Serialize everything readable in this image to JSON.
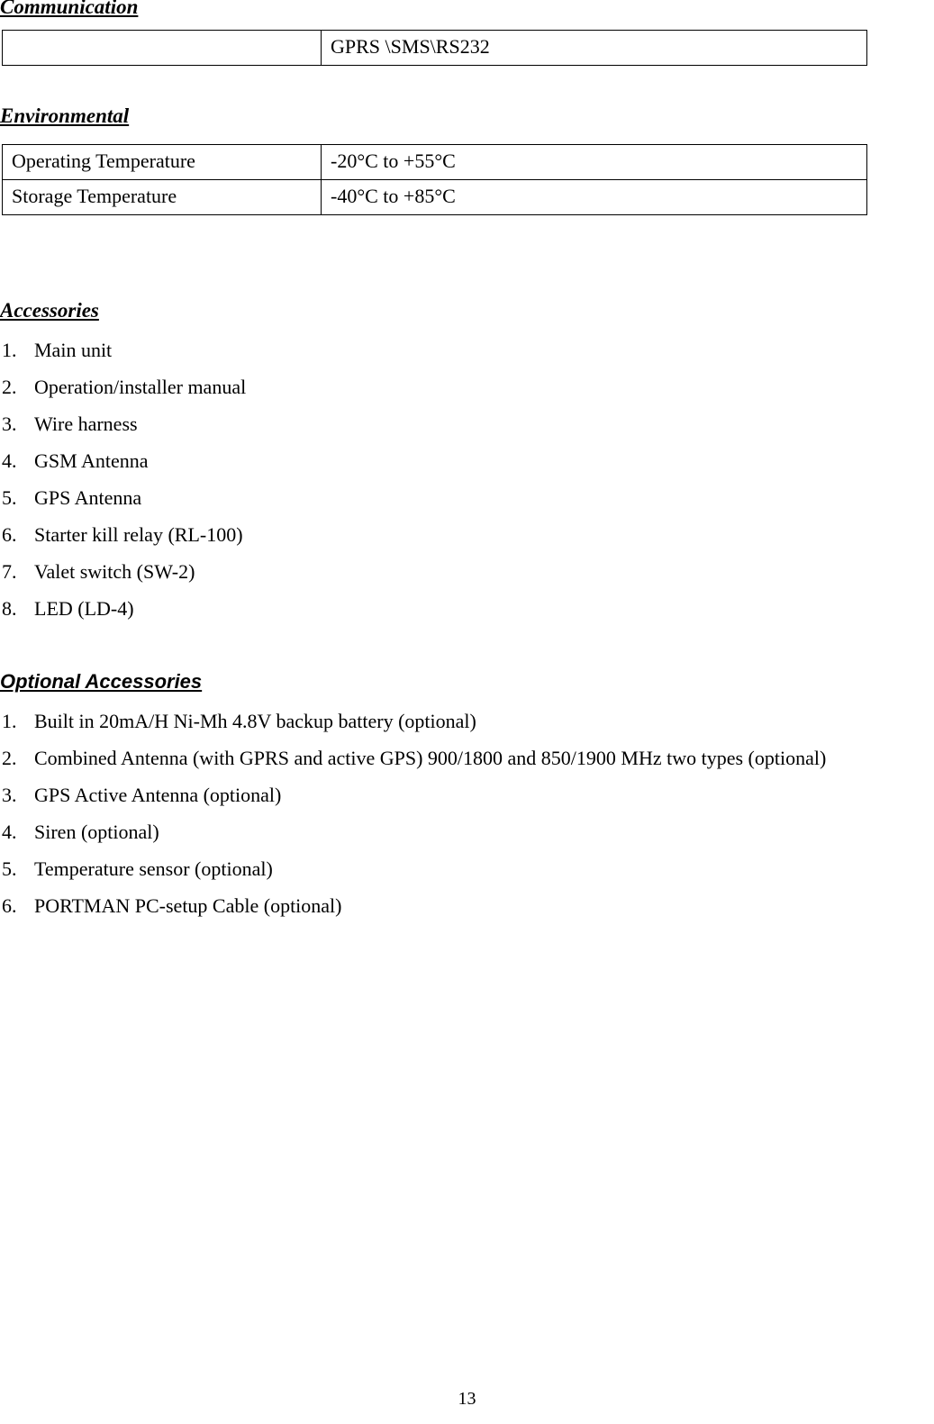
{
  "document": {
    "page_number": "13",
    "sections": {
      "communication": {
        "heading": "Communication",
        "rows": [
          {
            "label": "",
            "value": "GPRS \\SMS\\RS232"
          }
        ]
      },
      "environmental": {
        "heading": "Environmental",
        "rows": [
          {
            "label": "Operating Temperature",
            "value": "-20°C to +55°C"
          },
          {
            "label": "Storage Temperature",
            "value": "-40°C to +85°C"
          }
        ]
      },
      "accessories": {
        "heading": "Accessories",
        "items": [
          {
            "num": "1.",
            "text": "Main unit"
          },
          {
            "num": "2.",
            "text": "Operation/installer manual"
          },
          {
            "num": "3.",
            "text": "Wire harness"
          },
          {
            "num": "4.",
            "text": "GSM Antenna"
          },
          {
            "num": "5.",
            "text": "GPS Antenna"
          },
          {
            "num": "6.",
            "text": "Starter kill relay (RL-100)"
          },
          {
            "num": "7.",
            "text": "Valet switch (SW-2)"
          },
          {
            "num": "8.",
            "text": "LED (LD-4)"
          }
        ]
      },
      "optional_accessories": {
        "heading": "Optional Accessories",
        "items": [
          {
            "num": "1.",
            "text": "Built in 20mA/H Ni-Mh 4.8V backup battery (optional)"
          },
          {
            "num": "2.",
            "text": "Combined Antenna (with GPRS and active GPS) 900/1800 and 850/1900 MHz two types (optional)"
          },
          {
            "num": "3.",
            "text": "GPS Active Antenna (optional)"
          },
          {
            "num": "4.",
            "text": "Siren (optional)"
          },
          {
            "num": "5.",
            "text": "Temperature sensor (optional)"
          },
          {
            "num": "6.",
            "text": "PORTMAN PC-setup Cable (optional)"
          }
        ]
      }
    }
  }
}
